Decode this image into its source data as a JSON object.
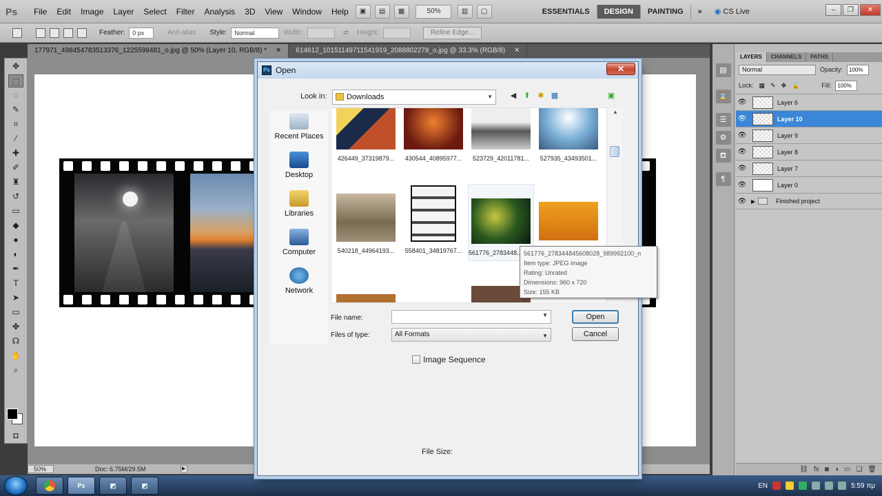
{
  "menubar": {
    "logo": "Ps",
    "items": [
      "File",
      "Edit",
      "Image",
      "Layer",
      "Select",
      "Filter",
      "Analysis",
      "3D",
      "View",
      "Window",
      "Help"
    ],
    "zoom": "50%",
    "workspaces": [
      "ESSENTIALS",
      "DESIGN",
      "PAINTING"
    ],
    "more": "»",
    "cslive": "CS Live"
  },
  "options": {
    "feather_label": "Feather:",
    "feather_value": "0 px",
    "antialias": "Anti-alias",
    "style_label": "Style:",
    "style_value": "Normal",
    "width_label": "Width:",
    "height_label": "Height:",
    "refine_edge": "Refine Edge..."
  },
  "tabs": [
    {
      "label": "177971_498454783513376_1225599481_o.jpg @ 50% (Layer 10, RGB/8) *"
    },
    {
      "label": "614612_10151149711541919_2088802278_o.jpg @ 33.3% (RGB/8)"
    }
  ],
  "status": {
    "zoom": "50%",
    "doc": "Doc: 6.75M/29.5M"
  },
  "layers_panel": {
    "tabs": [
      "LAYERS",
      "CHANNELS",
      "PATHS"
    ],
    "blend_mode": "Normal",
    "opacity_label": "Opacity:",
    "opacity_value": "100%",
    "lock_label": "Lock:",
    "fill_label": "Fill:",
    "fill_value": "100%",
    "layers": [
      "Layer 6",
      "Layer 10",
      "Layer 9",
      "Layer 8",
      "Layer 7",
      "Layer 0",
      "Finished project"
    ]
  },
  "dialog": {
    "title": "Open",
    "look_in_label": "Look in:",
    "look_in_value": "Downloads",
    "places": [
      "Recent Places",
      "Desktop",
      "Libraries",
      "Computer",
      "Network"
    ],
    "files": [
      "426449_37319879...",
      "430544_40895977...",
      "523729_42011781...",
      "527935_43493501...",
      "540218_44964193...",
      "558401_34819767...",
      "561776_2783448..."
    ],
    "tooltip": {
      "name": "561776_278344845608028_989992100_n",
      "type": "Item type: JPEG image",
      "rating": "Rating: Unrated",
      "dimensions": "Dimensions: 960 x 720",
      "size": "Size: 155 KB"
    },
    "file_name_label": "File name:",
    "file_name_value": "",
    "files_of_type_label": "Files of type:",
    "files_of_type_value": "All Formats",
    "open_button": "Open",
    "cancel_button": "Cancel",
    "image_sequence": "Image Sequence",
    "file_size_label": "File Size:"
  },
  "taskbar": {
    "lang": "EN",
    "time": "5:59 πμ"
  }
}
